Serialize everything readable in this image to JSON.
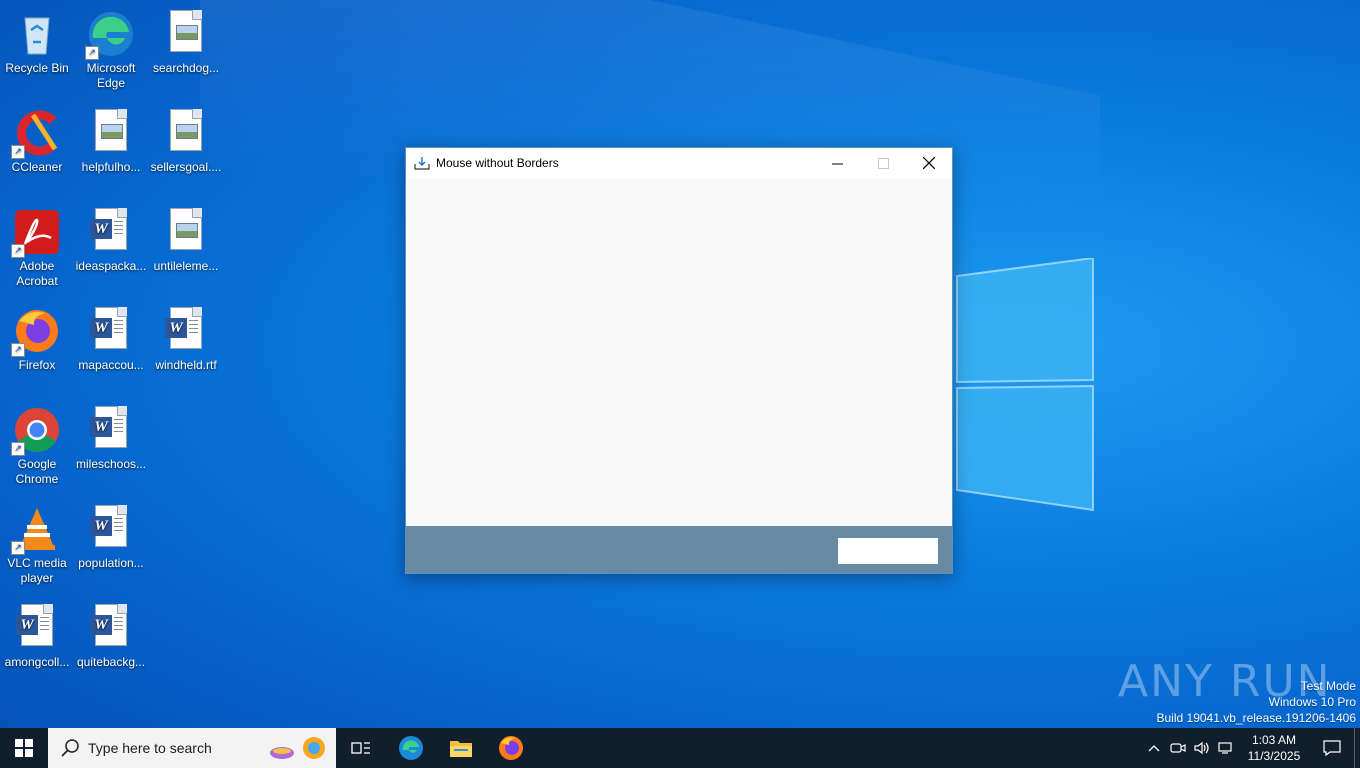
{
  "desktop": {
    "icons": [
      {
        "label": "Recycle Bin",
        "icon": "recycle-bin-icon"
      },
      {
        "label": "Microsoft Edge",
        "icon": "edge-icon"
      },
      {
        "label": "searchdog...",
        "icon": "image-file-icon"
      },
      {
        "label": "CCleaner",
        "icon": "ccleaner-icon"
      },
      {
        "label": "helpfulho...",
        "icon": "image-file-icon"
      },
      {
        "label": "sellersgoal....",
        "icon": "image-file-icon"
      },
      {
        "label": "Adobe Acrobat",
        "icon": "acrobat-icon"
      },
      {
        "label": "ideaspacka...",
        "icon": "word-doc-icon"
      },
      {
        "label": "untileleme...",
        "icon": "image-file-icon"
      },
      {
        "label": "Firefox",
        "icon": "firefox-icon"
      },
      {
        "label": "mapaccou...",
        "icon": "word-doc-icon"
      },
      {
        "label": "windheld.rtf",
        "icon": "word-doc-icon"
      },
      {
        "label": "Google Chrome",
        "icon": "chrome-icon"
      },
      {
        "label": "mileschoos...",
        "icon": "word-doc-icon"
      },
      {
        "label": "VLC media player",
        "icon": "vlc-icon"
      },
      {
        "label": "population...",
        "icon": "word-doc-icon"
      },
      {
        "label": "amongcoll...",
        "icon": "word-doc-icon"
      },
      {
        "label": "quitebackg...",
        "icon": "word-doc-icon"
      }
    ]
  },
  "window": {
    "title": "Mouse without Borders",
    "minimize": "—",
    "maximize": "☐",
    "close": "✕"
  },
  "taskbar": {
    "search_placeholder": "Type here to search",
    "clock_time": "1:03 AM",
    "clock_date": "11/3/2025"
  },
  "watermark": {
    "mode": "Test Mode",
    "edition": "Windows 10 Pro",
    "build": "Build 19041.vb_release.191206-1406",
    "brand": "ANY RUN"
  },
  "colors": {
    "footer": "#688aa3",
    "taskbar": "#111e2c",
    "desktop": "#0b7ee0"
  }
}
